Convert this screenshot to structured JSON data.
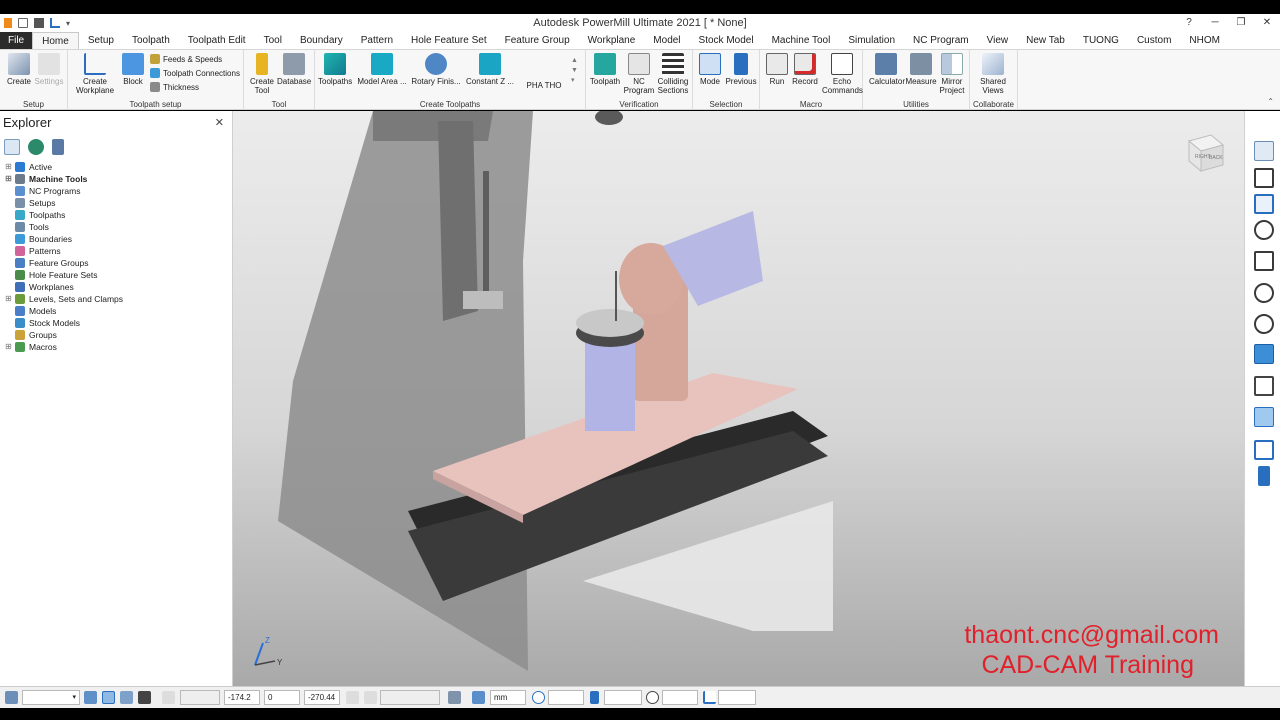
{
  "window": {
    "title": "Autodesk PowerMill Ultimate 2021   [ * None]"
  },
  "tabs": [
    "File",
    "Home",
    "Setup",
    "Toolpath",
    "Toolpath Edit",
    "Tool",
    "Boundary",
    "Pattern",
    "Hole Feature Set",
    "Feature Group",
    "Workplane",
    "Model",
    "Stock Model",
    "Machine Tool",
    "Simulation",
    "NC Program",
    "View",
    "New Tab",
    "TUONG",
    "Custom",
    "NHOM"
  ],
  "active_tab": "Home",
  "ribbon": {
    "setup": {
      "label": "Setup",
      "create": "Create",
      "settings": "Settings"
    },
    "toolpath_setup": {
      "label": "Toolpath setup",
      "create_workplane": "Create Workplane",
      "block": "Block",
      "feeds": "Feeds & Speeds",
      "connections": "Toolpath Connections",
      "thickness": "Thickness"
    },
    "tool": {
      "label": "Tool",
      "create_tool": "Create Tool",
      "database": "Database"
    },
    "create_toolpaths": {
      "label": "Create Toolpaths",
      "toolpaths": "Toolpaths",
      "model_area": "Model Area ...",
      "rotary": "Rotary Finis...",
      "constant_z": "Constant Z ...",
      "pha_tho": "PHA THO"
    },
    "verification": {
      "label": "Verification",
      "toolpath": "Toolpath",
      "nc_program": "NC Program",
      "colliding": "Colliding Sections"
    },
    "selection": {
      "label": "Selection",
      "mode": "Mode",
      "previous": "Previous"
    },
    "macro": {
      "label": "Macro",
      "run": "Run",
      "record": "Record",
      "echo": "Echo Commands"
    },
    "utilities": {
      "label": "Utilities",
      "calculator": "Calculator",
      "measure": "Measure",
      "mirror": "Mirror Project"
    },
    "collaborate": {
      "label": "Collaborate",
      "shared_views": "Shared Views"
    }
  },
  "explorer": {
    "title": "Explorer",
    "items": [
      {
        "label": "Active",
        "bold": false,
        "expandable": true,
        "color": "#2a7bd1"
      },
      {
        "label": "Machine Tools",
        "bold": true,
        "expandable": true,
        "color": "#6b7b8c"
      },
      {
        "label": "NC Programs",
        "bold": false,
        "expandable": false,
        "color": "#5a8fd0"
      },
      {
        "label": "Setups",
        "bold": false,
        "expandable": false,
        "color": "#7a8fa8"
      },
      {
        "label": "Toolpaths",
        "bold": false,
        "expandable": false,
        "color": "#38a8c9"
      },
      {
        "label": "Tools",
        "bold": false,
        "expandable": false,
        "color": "#6d8aa6"
      },
      {
        "label": "Boundaries",
        "bold": false,
        "expandable": false,
        "color": "#3d9ad8"
      },
      {
        "label": "Patterns",
        "bold": false,
        "expandable": false,
        "color": "#d0639a"
      },
      {
        "label": "Feature Groups",
        "bold": false,
        "expandable": false,
        "color": "#4a7fc4"
      },
      {
        "label": "Hole Feature Sets",
        "bold": false,
        "expandable": false,
        "color": "#4c8c4a"
      },
      {
        "label": "Workplanes",
        "bold": false,
        "expandable": false,
        "color": "#3f6fb7"
      },
      {
        "label": "Levels, Sets and Clamps",
        "bold": false,
        "expandable": true,
        "color": "#6c9b3b"
      },
      {
        "label": "Models",
        "bold": false,
        "expandable": false,
        "color": "#4b7ec9"
      },
      {
        "label": "Stock Models",
        "bold": false,
        "expandable": false,
        "color": "#3a8dc8"
      },
      {
        "label": "Groups",
        "bold": false,
        "expandable": false,
        "color": "#c9a23a"
      },
      {
        "label": "Macros",
        "bold": false,
        "expandable": true,
        "color": "#4a9a50"
      }
    ]
  },
  "viewport": {
    "viewcube_right": "RIGHT",
    "viewcube_back": "BACK",
    "axis_z": "Z",
    "axis_y": "Y",
    "watermark_email": "thaont.cnc@gmail.com",
    "watermark_training": "CAD-CAM Training"
  },
  "statusbar": {
    "x": "-174.2",
    "y": "0",
    "z": "-270.44",
    "units": "mm"
  }
}
